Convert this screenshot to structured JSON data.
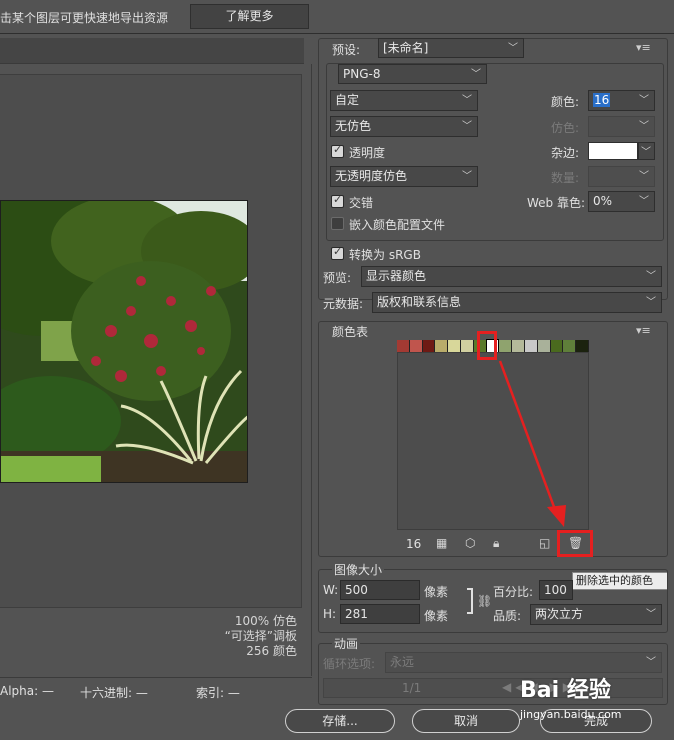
{
  "topbar": {
    "hint": "击某个图层可更快速地导出资源",
    "learn_more": "了解更多"
  },
  "preview_info": {
    "line1": "100% 仿色",
    "line2": "“可选择”调板",
    "line3": "256 颜色"
  },
  "status": {
    "alpha_label": "Alpha: —",
    "hex_label": "十六进制: —",
    "index_label": "索引: —"
  },
  "settings": {
    "preset_label": "预设:",
    "preset_value": "[未命名]",
    "format_value": "PNG-8",
    "reduction_value": "自定",
    "colors_label": "颜色:",
    "colors_value": "16",
    "dither_algo_value": "无仿色",
    "dither_label": "仿色:",
    "transparency_label": "透明度",
    "transparency_checked": true,
    "matte_label": "杂边:",
    "matte_color": "#ffffff",
    "transp_dither_value": "无透明度仿色",
    "amount_label": "数量:",
    "interlaced_label": "交错",
    "interlaced_checked": true,
    "web_snap_label": "Web 靠色:",
    "web_snap_value": "0%",
    "embed_profile_label": "嵌入颜色配置文件",
    "embed_profile_checked": false,
    "convert_srgb_label": "转换为 sRGB",
    "convert_srgb_checked": true,
    "preview_label": "预览:",
    "preview_value": "显示器颜色",
    "metadata_label": "元数据:",
    "metadata_value": "版权和联系信息"
  },
  "color_table": {
    "title": "颜色表",
    "count": "16",
    "swatches": [
      "#a33a33",
      "#c0554d",
      "#6e1a14",
      "#b9ac6a",
      "#d8d79a",
      "#d1cfa0",
      "#5a7a2a",
      "#ffffff",
      "#8fa36e",
      "#b4b99a",
      "#c8c8c8",
      "#a9b19a",
      "#4a6a1e",
      "#5f7f3a",
      "#1b220e"
    ]
  },
  "tooltip": "删除选中的颜色",
  "image_size": {
    "title": "图像大小",
    "w_label": "W:",
    "w_value": "500",
    "h_label": "H:",
    "h_value": "281",
    "unit": "像素",
    "percent_label": "百分比:",
    "percent_value": "100",
    "quality_label": "品质:",
    "quality_value": "两次立方"
  },
  "animation": {
    "title": "动画",
    "loop_label": "循环选项:",
    "loop_value": "永远",
    "frame": "1/1"
  },
  "footer": {
    "save": "存储...",
    "cancel": "取消",
    "done": "完成"
  },
  "watermark": {
    "brand": "Bai 经验",
    "url": "jingyan.baidu.com"
  }
}
